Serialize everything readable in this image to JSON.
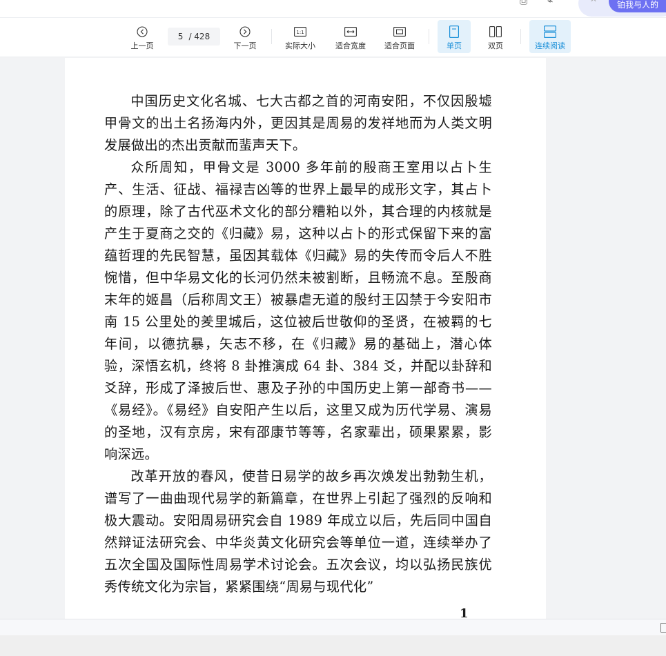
{
  "toolbar": {
    "prev_page": "上一页",
    "current_page": "5",
    "total_pages": "/ 428",
    "next_page": "下一页",
    "actual_size": "实际大小",
    "fit_width": "适合宽度",
    "fit_page": "适合页面",
    "single_page": "单页",
    "double_page": "双页",
    "continuous": "连续阅读",
    "accent_color": "#1a8fd8"
  },
  "top_bar": {
    "button_partial": "铂我与人的"
  },
  "document": {
    "paragraphs": [
      "中国历史文化名城、七大古都之首的河南安阳，不仅因殷墟甲骨文的出土名扬海内外，更因其是周易的发祥地而为人类文明发展做出的杰出贡献而蜚声天下。",
      "众所周知，甲骨文是 3000 多年前的殷商王室用以占卜生产、生活、征战、福禄吉凶等的世界上最早的成形文字，其占卜的原理，除了古代巫术文化的部分糟粕以外，其合理的内核就是产生于夏商之交的《归藏》易，这种以占卜的形式保留下来的富蕴哲理的先民智慧，虽因其载体《归藏》易的失传而令后人不胜惋惜，但中华易文化的长河仍然未被割断，且畅流不息。至殷商末年的姬昌（后称周文王）被暴虐无道的殷纣王囚禁于今安阳市南 15 公里处的羑里城后，这位被后世敬仰的圣贤，在被羁的七年间，以德抗暴，矢志不移，在《归藏》易的基础上，潜心体验，深悟玄机，终将 8 卦推演成 64 卦、384 爻，并配以卦辞和爻辞，形成了泽披后世、惠及子孙的中国历史上第一部奇书——《易经》。《易经》自安阳产生以后，这里又成为历代学易、演易的圣地，汉有京房，宋有邵康节等等，名家辈出，硕果累累，影响深远。",
      "改革开放的春风，使昔日易学的故乡再次焕发出勃勃生机，谱写了一曲曲现代易学的新篇章，在世界上引起了强烈的反响和极大震动。安阳周易研究会自 1989 年成立以后，先后同中国自然辩证法研究会、中华炎黄文化研究会等单位一道，连续举办了五次全国及国际性周易学术讨论会。五次会议，均以弘扬民族优秀传统文化为宗旨，紧紧围绕“周易与现代化”"
    ],
    "page_number": "1"
  }
}
